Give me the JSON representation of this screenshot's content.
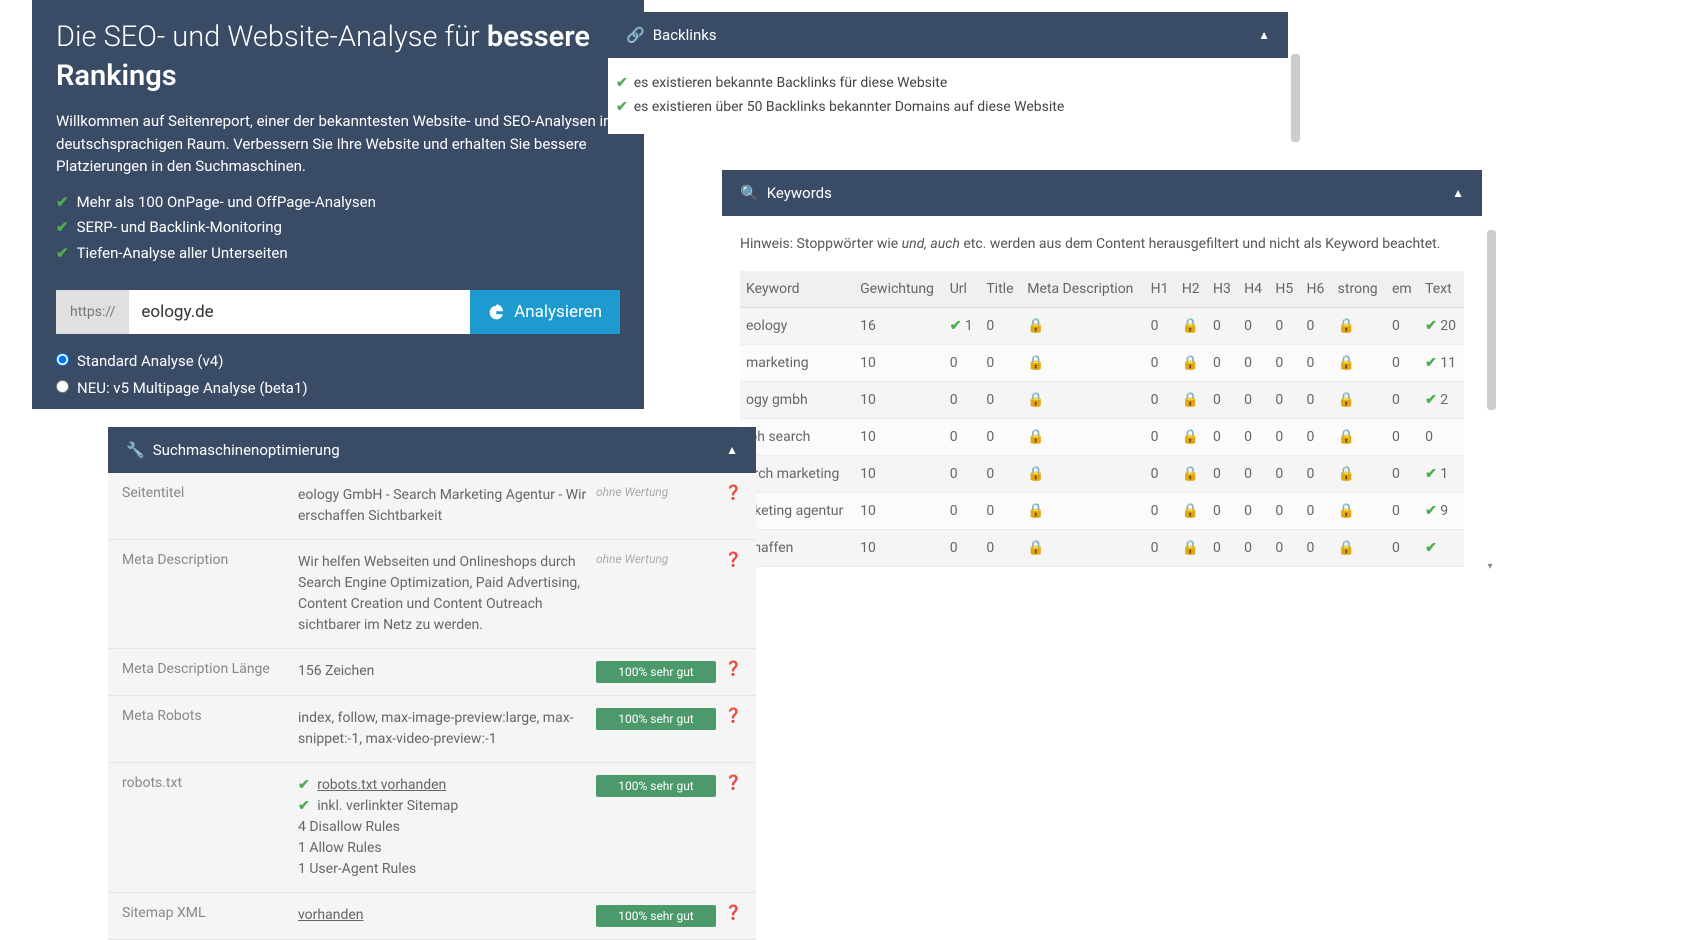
{
  "hero": {
    "title_pre": "Die SEO- und Website-Analyse für ",
    "title_bold": "bessere Rankings",
    "description": "Willkommen auf Seitenreport, einer der bekanntesten Website- und SEO-Analysen im deutschsprachigen Raum. Verbessern Sie Ihre Website und erhalten Sie bessere Platzierungen in den Suchmaschinen.",
    "features": [
      "Mehr als 100 OnPage- und OffPage-Analysen",
      "SERP- und Backlink-Monitoring",
      "Tiefen-Analyse aller Unterseiten"
    ],
    "protocol": "https://",
    "url_value": "eology.de",
    "analyze_label": "Analysieren",
    "radio_standard": "Standard Analyse (v4)",
    "radio_v5": "NEU: v5 Multipage Analyse (beta1)"
  },
  "backlinks": {
    "title": "Backlinks",
    "items": [
      "es existieren bekannte Backlinks für diese Website",
      "es existieren über 50 Backlinks bekannter Domains auf diese Website"
    ]
  },
  "keywords": {
    "title": "Keywords",
    "hint_pre": "Hinweis: Stoppwörter wie ",
    "hint_em": "und, auch",
    "hint_post": " etc. werden aus dem Content herausgefiltert und nicht als Keyword beachtet.",
    "headers": [
      "Keyword",
      "Gewichtung",
      "Url",
      "Title",
      "Meta Description",
      "H1",
      "H2",
      "H3",
      "H4",
      "H5",
      "H6",
      "strong",
      "em",
      "Text"
    ],
    "rows": [
      {
        "kw": "eology",
        "w": "16",
        "url": "✔1",
        "title": "0",
        "meta": "lock",
        "h1": "0",
        "h2": "lock",
        "h3": "0",
        "h4": "0",
        "h5": "0",
        "h6": "0",
        "strong": "lock",
        "em": "0",
        "text": "✔20"
      },
      {
        "kw": "marketing",
        "w": "10",
        "url": "0",
        "title": "0",
        "meta": "lock",
        "h1": "0",
        "h2": "lock",
        "h3": "0",
        "h4": "0",
        "h5": "0",
        "h6": "0",
        "strong": "lock",
        "em": "0",
        "text": "✔11"
      },
      {
        "kw": "ogy gmbh",
        "w": "10",
        "url": "0",
        "title": "0",
        "meta": "lock",
        "h1": "0",
        "h2": "lock",
        "h3": "0",
        "h4": "0",
        "h5": "0",
        "h6": "0",
        "strong": "lock",
        "em": "0",
        "text": "✔2"
      },
      {
        "kw": "ibh search",
        "w": "10",
        "url": "0",
        "title": "0",
        "meta": "lock",
        "h1": "0",
        "h2": "lock",
        "h3": "0",
        "h4": "0",
        "h5": "0",
        "h6": "0",
        "strong": "lock",
        "em": "0",
        "text": "0"
      },
      {
        "kw": "arch marketing",
        "w": "10",
        "url": "0",
        "title": "0",
        "meta": "lock",
        "h1": "0",
        "h2": "lock",
        "h3": "0",
        "h4": "0",
        "h5": "0",
        "h6": "0",
        "strong": "lock",
        "em": "0",
        "text": "✔1"
      },
      {
        "kw": "irketing agentur",
        "w": "10",
        "url": "0",
        "title": "0",
        "meta": "lock",
        "h1": "0",
        "h2": "lock",
        "h3": "0",
        "h4": "0",
        "h5": "0",
        "h6": "0",
        "strong": "lock",
        "em": "0",
        "text": "✔9"
      },
      {
        "kw": "chaffen",
        "w": "10",
        "url": "0",
        "title": "0",
        "meta": "lock",
        "h1": "0",
        "h2": "lock",
        "h3": "0",
        "h4": "0",
        "h5": "0",
        "h6": "0",
        "strong": "lock",
        "em": "0",
        "text": "✔"
      }
    ]
  },
  "seo": {
    "title": "Suchmaschinenoptimierung",
    "rows": [
      {
        "label": "Seitentitel",
        "value": "eology GmbH - Search Marketing Agentur - Wir erschaffen Sichtbarkeit",
        "rating": "ohne Wertung",
        "badge": ""
      },
      {
        "label": "Meta Description",
        "value": "Wir helfen Webseiten und Onlineshops durch Search Engine Optimization, Paid Advertising, Content Creation und Content Outreach sichtbarer im Netz zu werden.",
        "rating": "ohne Wertung",
        "badge": ""
      },
      {
        "label": "Meta Description Länge",
        "value": "156 Zeichen",
        "rating": "",
        "badge": "100% sehr gut"
      },
      {
        "label": "Meta Robots",
        "value": "index, follow, max-image-preview:large, max-snippet:-1, max-video-preview:-1",
        "rating": "",
        "badge": "100% sehr gut"
      },
      {
        "label": "robots.txt",
        "value": "",
        "rating": "",
        "badge": "100% sehr gut",
        "robots": true,
        "robots_link": "robots.txt vorhanden",
        "robots_line2": "inkl. verlinkter Sitemap",
        "robots_line3": "4 Disallow Rules",
        "robots_line4": "1 Allow Rules",
        "robots_line5": "1 User-Agent Rules"
      },
      {
        "label": "Sitemap XML",
        "value": "",
        "link": "vorhanden",
        "rating": "",
        "badge": "100% sehr gut"
      }
    ]
  }
}
